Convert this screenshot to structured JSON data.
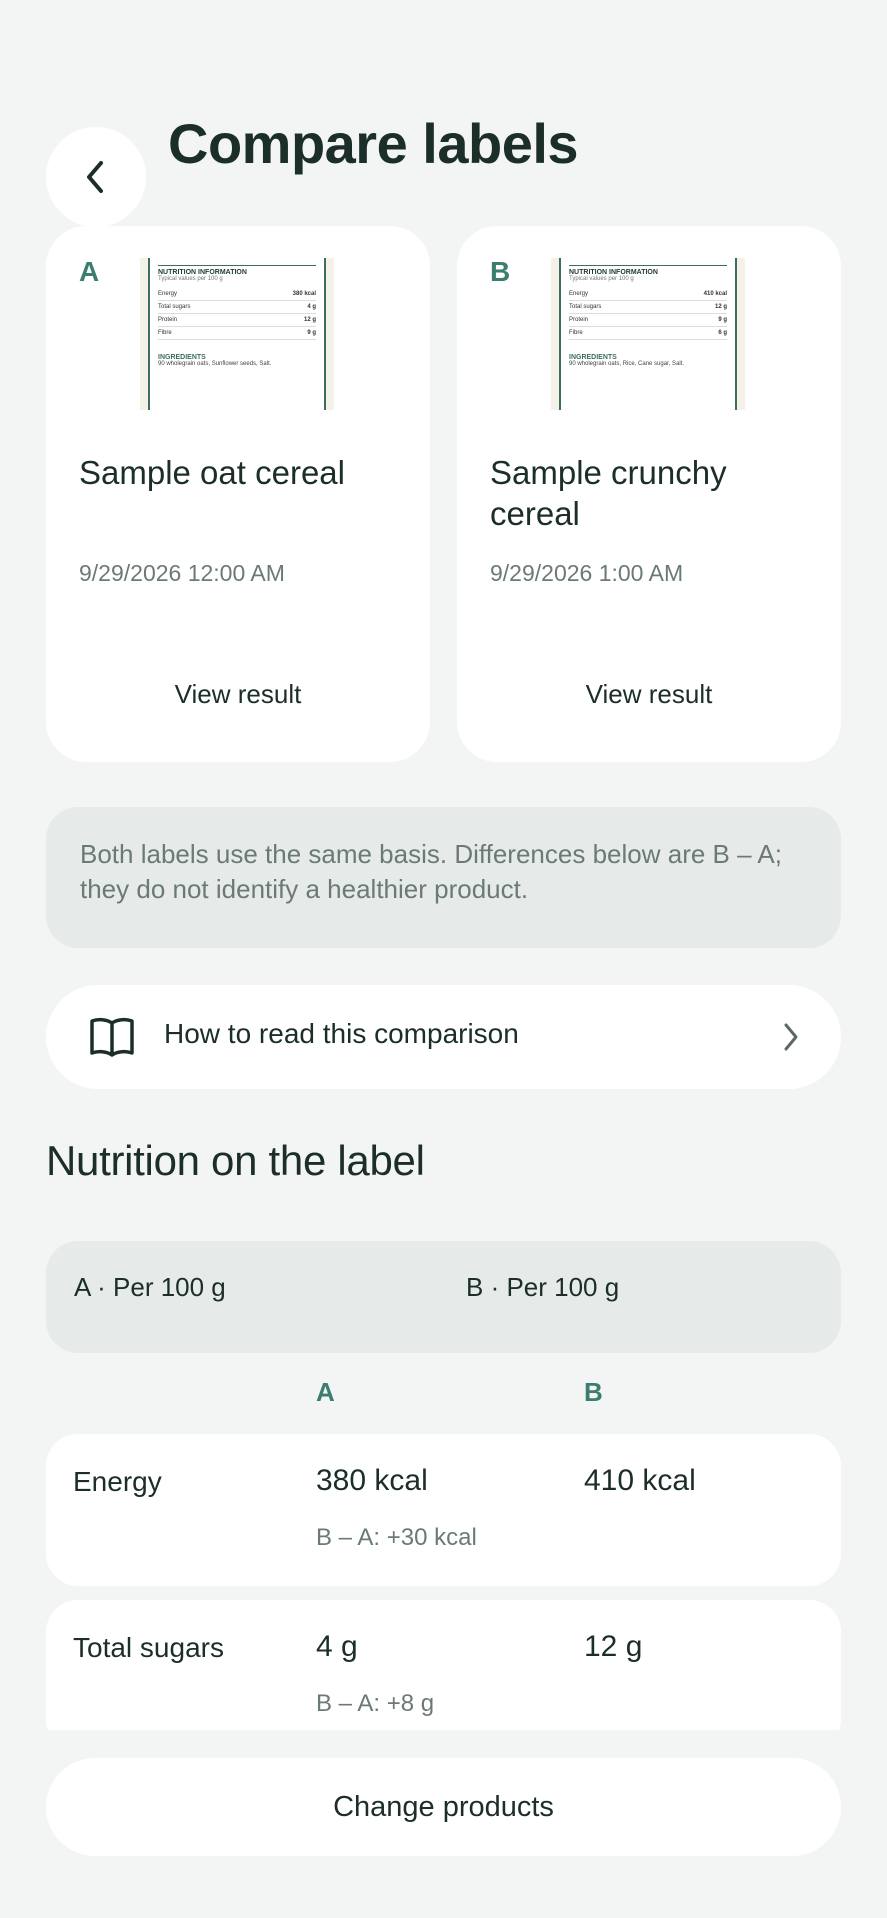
{
  "header": {
    "title": "Compare labels",
    "back_icon": "chevron-left-icon"
  },
  "products": [
    {
      "letter": "A",
      "name": "Sample oat cereal",
      "date": "9/29/2026 12:00 AM",
      "view_label": "View result",
      "thumb": {
        "heading": "NUTRITION INFORMATION",
        "sub": "Typical values per 100 g",
        "rows": [
          [
            "Energy",
            "380 kcal"
          ],
          [
            "Total sugars",
            "4 g"
          ],
          [
            "Protein",
            "12 g"
          ],
          [
            "Fibre",
            "9 g"
          ]
        ],
        "ingredients_heading": "INGREDIENTS",
        "ingredients": "90 wholegrain oats, Sunflower seeds, Salt."
      }
    },
    {
      "letter": "B",
      "name": "Sample crunchy cereal",
      "date": "9/29/2026 1:00 AM",
      "view_label": "View result",
      "thumb": {
        "heading": "NUTRITION INFORMATION",
        "sub": "Typical values per 100 g",
        "rows": [
          [
            "Energy",
            "410 kcal"
          ],
          [
            "Total sugars",
            "12 g"
          ],
          [
            "Protein",
            "9 g"
          ],
          [
            "Fibre",
            "6 g"
          ]
        ],
        "ingredients_heading": "INGREDIENTS",
        "ingredients": "90 wholegrain oats, Rice, Cane sugar, Salt."
      }
    }
  ],
  "note": "Both labels use the same basis. Differences below are B – A; they do not identify a healthier product.",
  "howto": {
    "label": "How to read this comparison",
    "icon": "book-icon",
    "chevron": "chevron-right-icon"
  },
  "nutrition": {
    "title": "Nutrition on the label",
    "basis_a": "A · Per 100 g",
    "basis_b": "B · Per 100 g",
    "col_a": "A",
    "col_b": "B",
    "rows": [
      {
        "label": "Energy",
        "a": "380 kcal",
        "b": "410 kcal",
        "diff": "B – A: +30 kcal"
      },
      {
        "label": "Total sugars",
        "a": "4 g",
        "b": "12 g",
        "diff": "B – A: +8 g"
      }
    ]
  },
  "footer": {
    "change_label": "Change products"
  },
  "colors": {
    "background": "#f3f5f4",
    "accent": "#3b7d6e",
    "text": "#1c2e2a",
    "muted": "#6c7a76",
    "panel": "#e6ebe9"
  }
}
